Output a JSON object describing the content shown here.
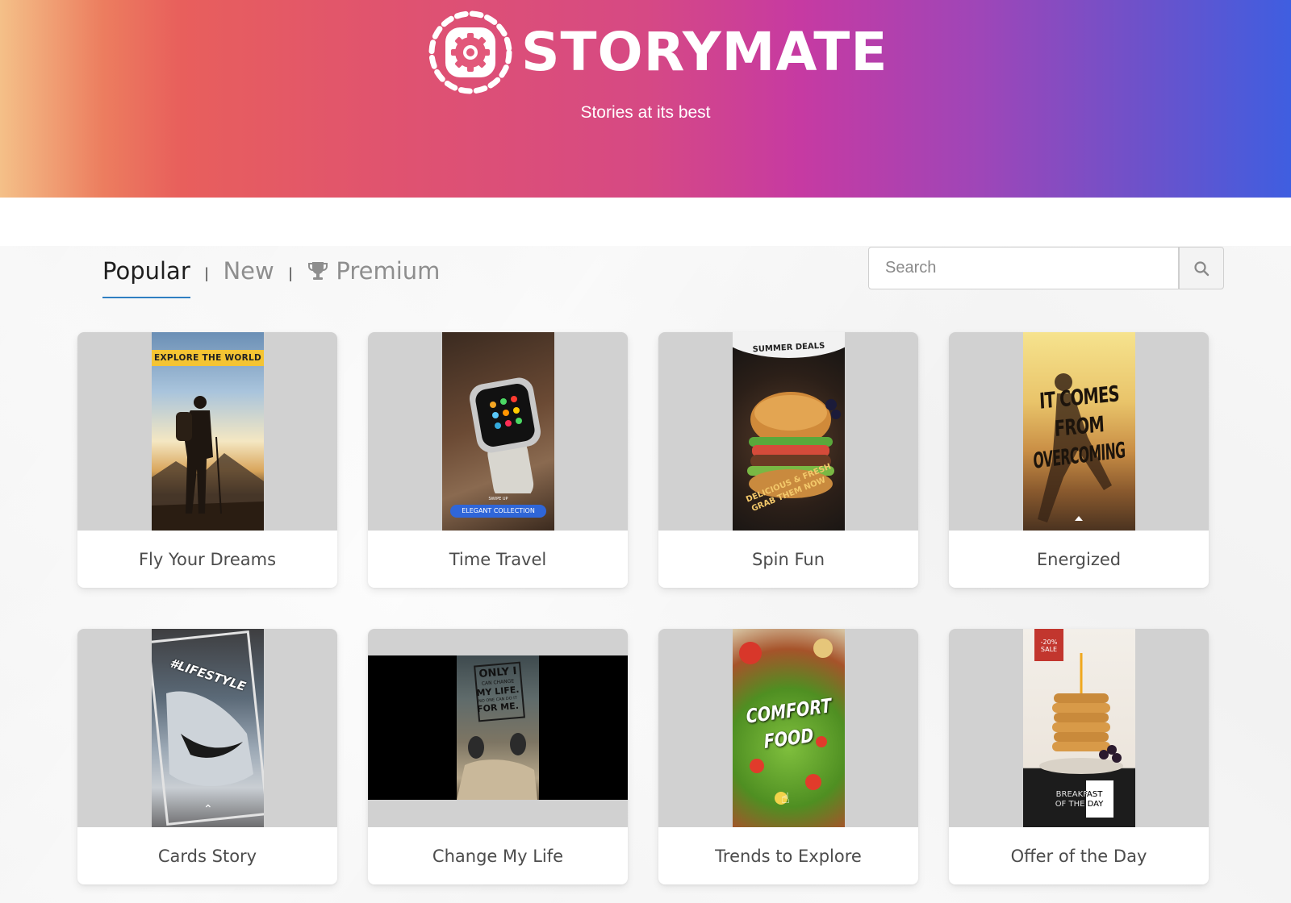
{
  "brand": {
    "name": "STORYMATE",
    "tagline": "Stories at its best"
  },
  "tabs": [
    {
      "label": "Popular",
      "active": true
    },
    {
      "label": "New",
      "active": false
    },
    {
      "label": "Premium",
      "active": false,
      "icon": "trophy-icon"
    }
  ],
  "tab_separator": "|",
  "search": {
    "placeholder": "Search",
    "value": "",
    "button_icon": "search-icon"
  },
  "colors": {
    "header_gradient": [
      "#f4c088",
      "#e85f5c",
      "#d64984",
      "#c63aa2",
      "#3f5ee0"
    ],
    "active_tab_underline": "#2f7fc2",
    "thumb_background": "#d1d1d1"
  },
  "cards": [
    {
      "title": "Fly Your Dreams",
      "poster": {
        "banner": "EXPLORE THE WORLD",
        "theme": "hiker-at-sunset"
      }
    },
    {
      "title": "Time Travel",
      "poster": {
        "small_text": "SWIPE UP",
        "badge": "ELEGANT COLLECTION",
        "theme": "smartwatch"
      }
    },
    {
      "title": "Spin Fun",
      "poster": {
        "header": "SUMMER DEALS",
        "overlay": [
          "DELICIOUS & FRESH",
          "GRAB THEM NOW"
        ],
        "theme": "burger"
      }
    },
    {
      "title": "Energized",
      "poster": {
        "headline": [
          "IT COMES",
          "FROM",
          "OVERCOMING"
        ],
        "theme": "runner"
      }
    },
    {
      "title": "Cards Story",
      "poster": {
        "headline": "#LIFESTYLE",
        "theme": "sneaker"
      }
    },
    {
      "title": "Change My Life",
      "poster": {
        "headline": [
          "ONLY I",
          "CAN CHANGE",
          "MY LIFE.",
          "NO ONE CAN DO IT",
          "FOR ME."
        ],
        "theme": "feet-on-rocks"
      }
    },
    {
      "title": "Trends to Explore",
      "poster": {
        "headline": [
          "COMFORT",
          "FOOD"
        ],
        "theme": "salad"
      }
    },
    {
      "title": "Offer of the Day",
      "poster": {
        "ribbon": [
          "-20%",
          "SALE"
        ],
        "footer": [
          "BREAKFAST",
          "OF THE DAY"
        ],
        "theme": "pancakes"
      }
    }
  ]
}
